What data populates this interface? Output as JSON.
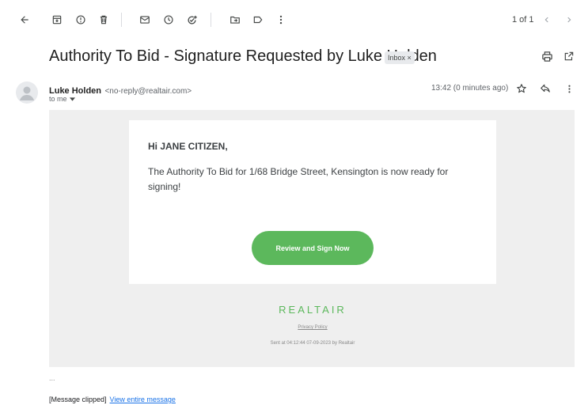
{
  "toolbar": {
    "pagination": "1 of 1",
    "icons": [
      "back-arrow-icon",
      "archive-icon",
      "report-spam-icon",
      "delete-icon",
      "mark-unread-icon",
      "snooze-icon",
      "add-task-icon",
      "move-to-icon",
      "label-icon",
      "more-vert-icon",
      "prev-chevron-icon",
      "next-chevron-icon"
    ]
  },
  "message": {
    "subject": "Authority To Bid - Signature Requested by Luke Holden",
    "label_badge": "Inbox ×",
    "sender_name": "Luke Holden",
    "sender_email": "<no-reply@realtair.com>",
    "recipient": "to me",
    "time": "13:42 (0 minutes ago)"
  },
  "email_body": {
    "greeting": "Hi JANE CITIZEN,",
    "text": "The Authority To Bid for 1/68 Bridge Street, Kensington is now ready for signing!",
    "cta_label": "Review and Sign Now",
    "brand": "REALTAIR",
    "privacy_link": "Privacy Policy",
    "sent_info": "Sent at 04:12:44 07-09-2023 by Realtair"
  },
  "footer": {
    "ellipsis": "...",
    "clipped_text": "[Message clipped]",
    "view_link": "View entire message"
  },
  "colors": {
    "accent_green": "#5cb85c",
    "link_blue": "#1a73e8",
    "email_background": "#efefef"
  }
}
